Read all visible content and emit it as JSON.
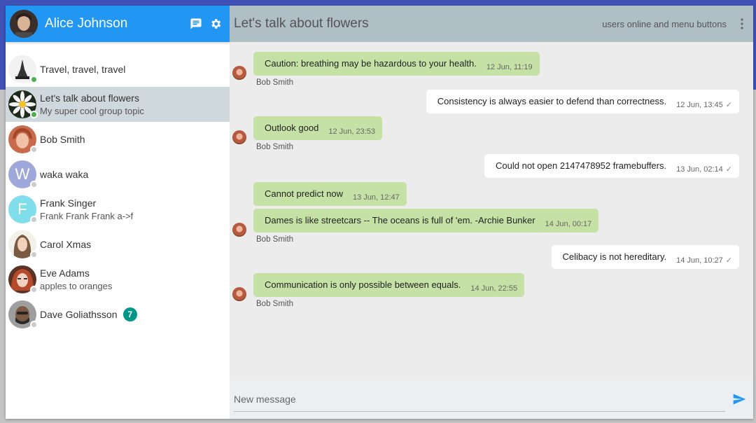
{
  "colors": {
    "header_blue": "#2196f3",
    "chat_header": "#b0bec5",
    "incoming_bubble": "#c5e1a5",
    "outgoing_bubble": "#ffffff",
    "online": "#4caf50",
    "offline": "#cccccc",
    "badge": "#009688",
    "send_icon": "#2196f3"
  },
  "sidebar": {
    "user_name": "Alice Johnson",
    "icons": [
      "chat-icon",
      "gear-icon"
    ],
    "contacts": [
      {
        "name": "Travel, travel, travel",
        "subtitle": "",
        "status": "online",
        "avatar": "photo-tower",
        "badge": ""
      },
      {
        "name": "Let's talk about flowers",
        "subtitle": "My super cool group topic",
        "status": "online",
        "avatar": "photo-flower",
        "badge": ""
      },
      {
        "name": "Bob Smith",
        "subtitle": "",
        "status": "offline",
        "avatar": "photo-bob",
        "badge": ""
      },
      {
        "name": "waka waka",
        "subtitle": "",
        "status": "offline",
        "avatar": "W",
        "badge": ""
      },
      {
        "name": "Frank Singer",
        "subtitle": "Frank Frank Frank a->f",
        "status": "offline",
        "avatar": "F",
        "badge": ""
      },
      {
        "name": "Carol Xmas",
        "subtitle": "",
        "status": "offline",
        "avatar": "photo-carol",
        "badge": ""
      },
      {
        "name": "Eve Adams",
        "subtitle": "apples to oranges",
        "status": "offline",
        "avatar": "photo-eve",
        "badge": ""
      },
      {
        "name": "Dave Goliathsson",
        "subtitle": "",
        "status": "offline",
        "avatar": "photo-dave",
        "badge": "7"
      }
    ]
  },
  "chat": {
    "title": "Let's talk about flowers",
    "actions_text": "users online and menu buttons",
    "messages": [
      {
        "direction": "in",
        "text": "Caution: breathing may be hazardous to your health.",
        "time": "12 Jun, 11:19",
        "sender": "Bob Smith"
      },
      {
        "direction": "out",
        "text": "Consistency is always easier to defend than correctness.",
        "time": "12 Jun, 13:45",
        "sender": ""
      },
      {
        "direction": "in",
        "text": "Outlook good",
        "time": "12 Jun, 23:53",
        "sender": "Bob Smith"
      },
      {
        "direction": "out",
        "text": "Could not open 2147478952 framebuffers.",
        "time": "13 Jun, 02:14",
        "sender": ""
      },
      {
        "direction": "in",
        "text": "Cannot predict now",
        "time": "13 Jun, 12:47",
        "sender": ""
      },
      {
        "direction": "in",
        "text": "Dames is like streetcars -- The oceans is full of 'em. -Archie Bunker",
        "time": "14 Jun, 00:17",
        "sender": "Bob Smith"
      },
      {
        "direction": "out",
        "text": "Celibacy is not hereditary.",
        "time": "14 Jun, 10:27",
        "sender": ""
      },
      {
        "direction": "in",
        "text": "Communication is only possible between equals.",
        "time": "14 Jun, 22:55",
        "sender": "Bob Smith"
      }
    ]
  },
  "composer": {
    "placeholder": "New message",
    "send_icon": "send-icon"
  }
}
